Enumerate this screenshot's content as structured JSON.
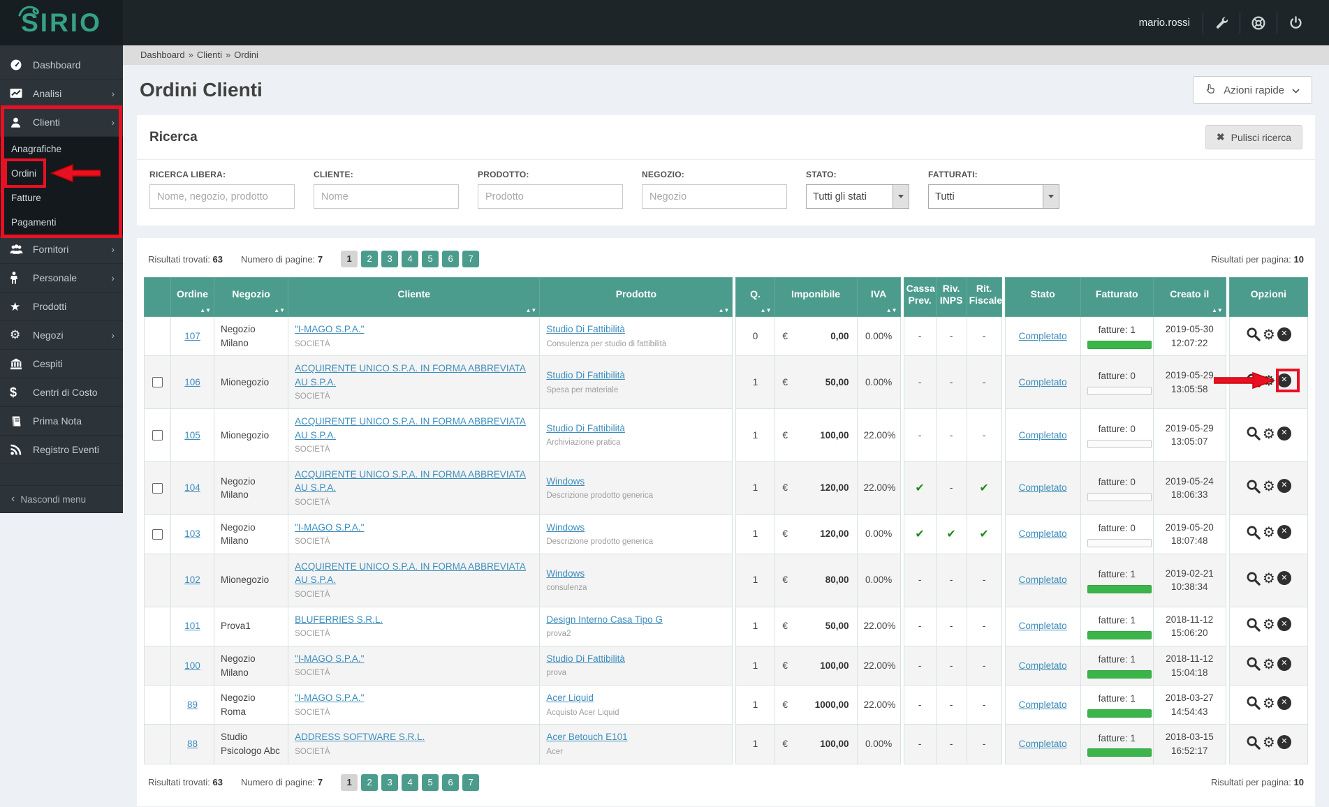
{
  "navbar": {
    "logo": "SIRIO",
    "username": "mario.rossi"
  },
  "sidebar": {
    "items": [
      {
        "label": "Dashboard"
      },
      {
        "label": "Analisi",
        "chevron": "›"
      },
      {
        "label": "Clienti",
        "chevron": "›"
      },
      {
        "label": "Fornitori",
        "chevron": "›"
      },
      {
        "label": "Personale",
        "chevron": "›"
      },
      {
        "label": "Prodotti"
      },
      {
        "label": "Negozi",
        "chevron": "›"
      },
      {
        "label": "Cespiti"
      },
      {
        "label": "Centri di Costo"
      },
      {
        "label": "Prima Nota"
      },
      {
        "label": "Registro Eventi"
      }
    ],
    "submenu": [
      "Anagrafiche",
      "Ordini",
      "Fatture",
      "Pagamenti"
    ],
    "hide_menu": "Nascondi menu"
  },
  "breadcrumb": {
    "items": [
      "Dashboard",
      "Clienti",
      "Ordini"
    ],
    "separator": "»"
  },
  "page": {
    "title": "Ordini Clienti",
    "quick_actions": "Azioni rapide"
  },
  "search": {
    "title": "Ricerca",
    "clear_button": "Pulisci ricerca",
    "fields": [
      {
        "label": "RICERCA LIBERA:",
        "placeholder": "Nome, negozio, prodotto"
      },
      {
        "label": "CLIENTE:",
        "placeholder": "Nome"
      },
      {
        "label": "PRODOTTO:",
        "placeholder": "Prodotto"
      },
      {
        "label": "NEGOZIO:",
        "placeholder": "Negozio"
      }
    ],
    "selects": [
      {
        "label": "STATO:",
        "value": "Tutti gli stati"
      },
      {
        "label": "FATTURATI:",
        "value": "Tutti"
      }
    ]
  },
  "results": {
    "found_label": "Risultati trovati:",
    "found": "63",
    "pages_label": "Numero di pagine:",
    "pages": "7",
    "page_numbers": [
      "1",
      "2",
      "3",
      "4",
      "5",
      "6",
      "7"
    ],
    "active_page": "1",
    "per_page_label": "Risultati per pagina:",
    "per_page": "10"
  },
  "colors": {
    "teal": "#4c9c8d",
    "link_blue": "#3c8dbc",
    "bar_green": "#3bb54a",
    "check_green": "#1e8e1e",
    "annotation_red": "#e81123"
  },
  "table": {
    "headers": [
      {
        "key": "check",
        "label": "",
        "sortable": false
      },
      {
        "key": "ordine",
        "label": "Ordine",
        "sortable": true
      },
      {
        "key": "negozio",
        "label": "Negozio",
        "sortable": true
      },
      {
        "key": "cliente",
        "label": "Cliente",
        "sortable": true
      },
      {
        "key": "prodotto",
        "label": "Prodotto",
        "sortable": true
      },
      {
        "key": "q",
        "label": "Q.",
        "sortable": true
      },
      {
        "key": "imponibile",
        "label": "Imponibile",
        "sortable": false
      },
      {
        "key": "iva",
        "label": "IVA",
        "sortable": true
      },
      {
        "key": "cassa",
        "label": "Cassa Prev.",
        "sortable": false
      },
      {
        "key": "riv",
        "label": "Riv. INPS",
        "sortable": false
      },
      {
        "key": "rit",
        "label": "Rit. Fiscale",
        "sortable": false
      },
      {
        "key": "stato",
        "label": "Stato",
        "sortable": false
      },
      {
        "key": "fatturato",
        "label": "Fatturato",
        "sortable": false
      },
      {
        "key": "creato",
        "label": "Creato il",
        "sortable": true
      },
      {
        "key": "opzioni",
        "label": "Opzioni",
        "sortable": false
      }
    ],
    "rows": [
      {
        "ordine": "107",
        "negozio": "Negozio Milano",
        "cliente": "\"I-MAGO S.P.A.\"",
        "cliente_tipo": "SOCIETÀ",
        "prodotto": "Studio Di Fattibilità",
        "prodotto_desc": "Consulenza per studio di fattibilità",
        "q": "0",
        "imponibile": "0,00",
        "iva": "0.00%",
        "cassa": "-",
        "riv": "-",
        "rit": "-",
        "stato": "Completato",
        "fatture": "fatture: 1",
        "fatture_full": true,
        "creato_data": "2019-05-30",
        "creato_ora": "12:07:22",
        "checkbox": false,
        "annotated": false
      },
      {
        "ordine": "106",
        "negozio": "Mionegozio",
        "cliente": "ACQUIRENTE UNICO S.P.A. IN FORMA ABBREVIATA AU S.P.A.",
        "cliente_tipo": "SOCIETÀ",
        "prodotto": "Studio Di Fattibilità",
        "prodotto_desc": "Spesa per materiale",
        "q": "1",
        "imponibile": "50,00",
        "iva": "0.00%",
        "cassa": "-",
        "riv": "-",
        "rit": "-",
        "stato": "Completato",
        "fatture": "fatture: 0",
        "fatture_full": false,
        "creato_data": "2019-05-29",
        "creato_ora": "13:05:58",
        "checkbox": true,
        "annotated": true
      },
      {
        "ordine": "105",
        "negozio": "Mionegozio",
        "cliente": "ACQUIRENTE UNICO S.P.A. IN FORMA ABBREVIATA AU S.P.A.",
        "cliente_tipo": "SOCIETÀ",
        "prodotto": "Studio Di Fattibilità",
        "prodotto_desc": "Archiviazione pratica",
        "q": "1",
        "imponibile": "100,00",
        "iva": "22.00%",
        "cassa": "-",
        "riv": "-",
        "rit": "-",
        "stato": "Completato",
        "fatture": "fatture: 0",
        "fatture_full": false,
        "creato_data": "2019-05-29",
        "creato_ora": "13:05:07",
        "checkbox": true,
        "annotated": false
      },
      {
        "ordine": "104",
        "negozio": "Negozio Milano",
        "cliente": "ACQUIRENTE UNICO S.P.A. IN FORMA ABBREVIATA AU S.P.A.",
        "cliente_tipo": "SOCIETÀ",
        "prodotto": "Windows",
        "prodotto_desc": "Descrizione prodotto generica",
        "q": "1",
        "imponibile": "120,00",
        "iva": "22.00%",
        "cassa": "check",
        "riv": "-",
        "rit": "check",
        "stato": "Completato",
        "fatture": "fatture: 0",
        "fatture_full": false,
        "creato_data": "2019-05-24",
        "creato_ora": "18:06:33",
        "checkbox": true,
        "annotated": false
      },
      {
        "ordine": "103",
        "negozio": "Negozio Milano",
        "cliente": "\"I-MAGO S.P.A.\"",
        "cliente_tipo": "SOCIETÀ",
        "prodotto": "Windows",
        "prodotto_desc": "Descrizione prodotto generica",
        "q": "1",
        "imponibile": "120,00",
        "iva": "0.00%",
        "cassa": "check",
        "riv": "check",
        "rit": "check",
        "stato": "Completato",
        "fatture": "fatture: 0",
        "fatture_full": false,
        "creato_data": "2019-05-20",
        "creato_ora": "18:07:48",
        "checkbox": true,
        "annotated": false
      },
      {
        "ordine": "102",
        "negozio": "Mionegozio",
        "cliente": "ACQUIRENTE UNICO S.P.A. IN FORMA ABBREVIATA AU S.P.A.",
        "cliente_tipo": "SOCIETÀ",
        "prodotto": "Windows",
        "prodotto_desc": "consulenza",
        "q": "1",
        "imponibile": "80,00",
        "iva": "0.00%",
        "cassa": "-",
        "riv": "-",
        "rit": "-",
        "stato": "Completato",
        "fatture": "fatture: 1",
        "fatture_full": true,
        "creato_data": "2019-02-21",
        "creato_ora": "10:38:34",
        "checkbox": false,
        "annotated": false
      },
      {
        "ordine": "101",
        "negozio": "Prova1",
        "cliente": "BLUFERRIES S.R.L.",
        "cliente_tipo": "SOCIETÀ",
        "prodotto": "Design Interno Casa Tipo G",
        "prodotto_desc": "prova2",
        "q": "1",
        "imponibile": "50,00",
        "iva": "22.00%",
        "cassa": "-",
        "riv": "-",
        "rit": "-",
        "stato": "Completato",
        "fatture": "fatture: 1",
        "fatture_full": true,
        "creato_data": "2018-11-12",
        "creato_ora": "15:06:20",
        "checkbox": false,
        "annotated": false
      },
      {
        "ordine": "100",
        "negozio": "Negozio Milano",
        "cliente": "\"I-MAGO S.P.A.\"",
        "cliente_tipo": "SOCIETÀ",
        "prodotto": "Studio Di Fattibilità",
        "prodotto_desc": "prova",
        "q": "1",
        "imponibile": "100,00",
        "iva": "22.00%",
        "cassa": "-",
        "riv": "-",
        "rit": "-",
        "stato": "Completato",
        "fatture": "fatture: 1",
        "fatture_full": true,
        "creato_data": "2018-11-12",
        "creato_ora": "15:04:18",
        "checkbox": false,
        "annotated": false
      },
      {
        "ordine": "89",
        "negozio": "Negozio Roma",
        "cliente": "\"I-MAGO S.P.A.\"",
        "cliente_tipo": "SOCIETÀ",
        "prodotto": "Acer Liquid",
        "prodotto_desc": "Acquisto Acer Liquid",
        "q": "1",
        "imponibile": "1000,00",
        "iva": "22.00%",
        "cassa": "-",
        "riv": "-",
        "rit": "-",
        "stato": "Completato",
        "fatture": "fatture: 1",
        "fatture_full": true,
        "creato_data": "2018-03-27",
        "creato_ora": "14:54:43",
        "checkbox": false,
        "annotated": false
      },
      {
        "ordine": "88",
        "negozio": "Studio Psicologo Abc",
        "cliente": "ADDRESS SOFTWARE S.R.L.",
        "cliente_tipo": "SOCIETÀ",
        "prodotto": "Acer Betouch E101",
        "prodotto_desc": "Acer",
        "q": "1",
        "imponibile": "100,00",
        "iva": "0.00%",
        "cassa": "-",
        "riv": "-",
        "rit": "-",
        "stato": "Completato",
        "fatture": "fatture: 1",
        "fatture_full": true,
        "creato_data": "2018-03-15",
        "creato_ora": "16:52:17",
        "checkbox": false,
        "annotated": false
      }
    ]
  }
}
